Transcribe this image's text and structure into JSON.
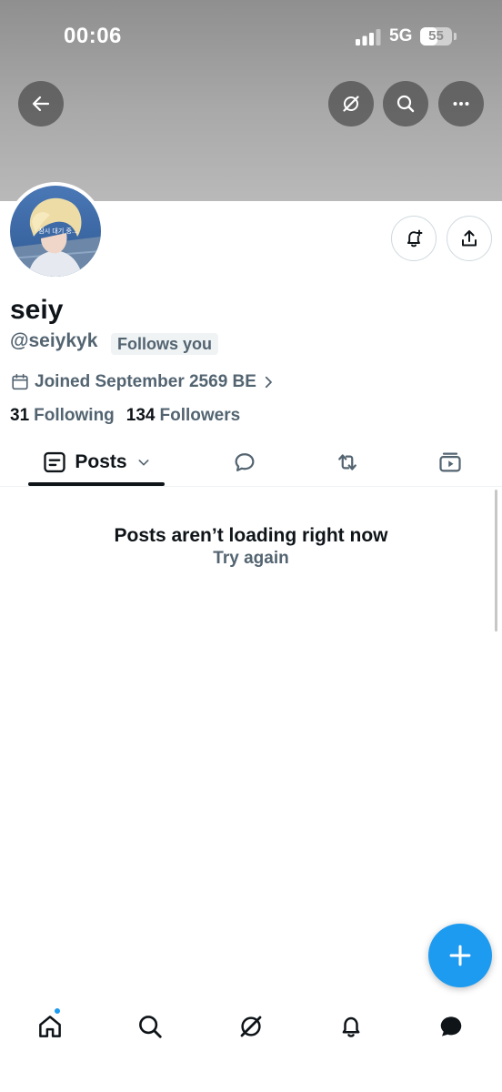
{
  "status_bar": {
    "time": "00:06",
    "network": "5G",
    "battery_percent": "55",
    "battery_level": 0.55,
    "signal_bars": 3
  },
  "header": {
    "back_icon": "arrow-left-icon",
    "grok_icon": "grok-icon",
    "search_icon": "search-icon",
    "more_icon": "more-horizontal-icon",
    "banner_color": "#a2a2a2"
  },
  "profile": {
    "avatar_caption": "잠시 대기 중...",
    "display_name": "seiy",
    "handle": "@seiykyk",
    "follows_you": "Follows you",
    "joined": "Joined September 2569 BE",
    "following_count": "31",
    "following_label": "Following",
    "followers_count": "134",
    "followers_label": "Followers"
  },
  "actions": {
    "notify_icon": "bell-plus-icon",
    "share_icon": "share-icon"
  },
  "tabs": [
    {
      "label": "Posts",
      "icon": "posts-icon",
      "active": true
    },
    {
      "label": "",
      "icon": "reply-bubble-icon"
    },
    {
      "label": "",
      "icon": "repost-icon"
    },
    {
      "label": "",
      "icon": "media-video-icon"
    }
  ],
  "feed": {
    "message": "Posts aren’t loading right now",
    "retry": "Try again"
  },
  "fab": {
    "icon": "plus-icon",
    "color": "#1d9bf0"
  },
  "bottom_nav": [
    {
      "icon": "home-icon",
      "has_badge": true
    },
    {
      "icon": "search-icon"
    },
    {
      "icon": "grok-icon"
    },
    {
      "icon": "bell-icon"
    },
    {
      "icon": "chat-icon"
    }
  ],
  "colors": {
    "accent": "#1d9bf0",
    "text_primary": "#0f1419",
    "text_secondary": "#536471"
  }
}
